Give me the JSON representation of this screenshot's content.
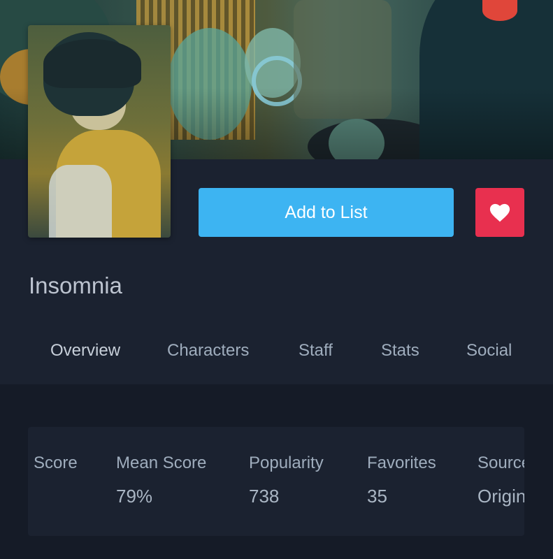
{
  "colors": {
    "page_bg": "#151b27",
    "panel_bg": "#1b2230",
    "primary_blue": "#3db4f2",
    "favorite_red": "#e8304f",
    "title_text": "#bcc3cf",
    "muted_text": "#9fadbd"
  },
  "header": {
    "banner_image": "anime-banner",
    "cover_image": "cover-art"
  },
  "actions": {
    "add_to_list_label": "Add to List",
    "favorite_icon": "heart-icon"
  },
  "media": {
    "title": "Insomnia"
  },
  "tabs": [
    {
      "label": "Overview",
      "active": true
    },
    {
      "label": "Characters",
      "active": false
    },
    {
      "label": "Staff",
      "active": false
    },
    {
      "label": "Stats",
      "active": false
    },
    {
      "label": "Social",
      "active": false
    }
  ],
  "stats": [
    {
      "label": "Score",
      "value": ""
    },
    {
      "label": "Mean Score",
      "value": "79%"
    },
    {
      "label": "Popularity",
      "value": "738"
    },
    {
      "label": "Favorites",
      "value": "35"
    },
    {
      "label": "Source",
      "value": "Original"
    }
  ]
}
